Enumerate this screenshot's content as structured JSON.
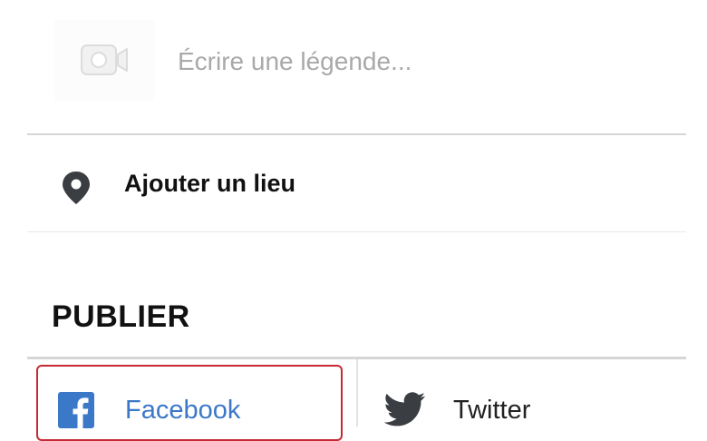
{
  "caption": {
    "placeholder": "Écrire une légende...",
    "value": "",
    "thumbnail_icon": "video-camera-icon"
  },
  "location": {
    "label": "Ajouter un lieu",
    "icon": "location-pin-icon"
  },
  "publish": {
    "heading": "PUBLIER",
    "targets": [
      {
        "label": "Facebook",
        "icon": "facebook-icon",
        "highlighted": true,
        "color": "#3b78c8"
      },
      {
        "label": "Twitter",
        "icon": "twitter-icon",
        "highlighted": false
      }
    ]
  },
  "colors": {
    "highlight_border": "#c52a34",
    "facebook_brand": "#3b78c8",
    "icon_dark": "#3a3d42",
    "placeholder_text": "#a9a9a9"
  }
}
